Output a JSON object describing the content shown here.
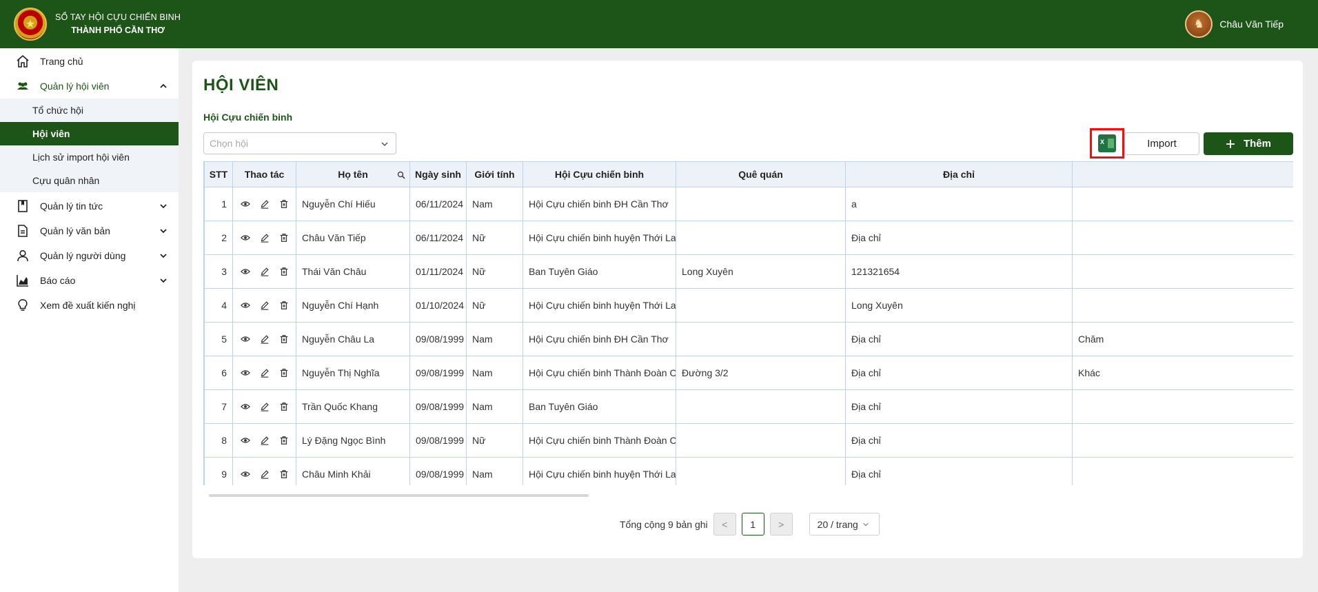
{
  "header": {
    "brand_line1": "SỔ TAY HỘI CỰU CHIẾN BINH",
    "brand_line2": "THÀNH PHỐ CẦN THƠ",
    "user_name": "Châu Văn Tiếp",
    "colors": {
      "primary": "#1d5518",
      "highlight": "#ff0a0a"
    }
  },
  "sidebar": {
    "home": "Trang chủ",
    "members_group": "Quản lý hội viên",
    "members_sub": [
      "Tổ chức hội",
      "Hội viên",
      "Lịch sử import hội viên",
      "Cựu quân nhân"
    ],
    "news": "Quản lý tin tức",
    "docs": "Quản lý văn bản",
    "users": "Quản lý người dùng",
    "reports": "Báo cáo",
    "suggestions": "Xem đề xuất kiến nghị"
  },
  "main": {
    "title": "HỘI VIÊN",
    "filter_label": "Hội Cựu chiến binh",
    "filter_placeholder": "Chọn hội",
    "import_label": "Import",
    "add_label": "Thêm",
    "columns": [
      "STT",
      "Thao tác",
      "Họ tên",
      "Ngày sinh",
      "Giới tính",
      "Hội Cựu chiến binh",
      "Quê quán",
      "Địa chỉ",
      ""
    ],
    "rows": [
      {
        "stt": "1",
        "name": "Nguyễn Chí Hiếu",
        "dob": "06/11/2024",
        "gender": "Nam",
        "assoc": "Hội Cựu chiến binh ĐH Cần Thơ",
        "hometown": "",
        "address": "a",
        "extra": ""
      },
      {
        "stt": "2",
        "name": "Châu Văn Tiếp",
        "dob": "06/11/2024",
        "gender": "Nữ",
        "assoc": "Hội Cựu chiến binh huyện Thới Lai",
        "hometown": "",
        "address": "Địa chỉ",
        "extra": ""
      },
      {
        "stt": "3",
        "name": "Thái Văn Châu",
        "dob": "01/11/2024",
        "gender": "Nữ",
        "assoc": "Ban Tuyên Giáo",
        "hometown": "Long Xuyên",
        "address": "121321654",
        "extra": ""
      },
      {
        "stt": "4",
        "name": "Nguyễn Chí Hạnh",
        "dob": "01/10/2024",
        "gender": "Nữ",
        "assoc": "Hội Cựu chiến binh huyện Thới Lai",
        "hometown": "",
        "address": "Long Xuyên",
        "extra": ""
      },
      {
        "stt": "5",
        "name": "Nguyễn Châu La",
        "dob": "09/08/1999",
        "gender": "Nam",
        "assoc": "Hội Cựu chiến binh ĐH Cần Thơ",
        "hometown": "",
        "address": "Địa chỉ",
        "extra": "Chăm"
      },
      {
        "stt": "6",
        "name": "Nguyễn Thị Nghĩa",
        "dob": "09/08/1999",
        "gender": "Nam",
        "assoc": "Hội Cựu chiến binh Thành Đoàn Cần Thơ",
        "hometown": "Đường 3/2",
        "address": "Địa chỉ",
        "extra": "Khác"
      },
      {
        "stt": "7",
        "name": "Trần Quốc Khang",
        "dob": "09/08/1999",
        "gender": "Nam",
        "assoc": "Ban Tuyên Giáo",
        "hometown": "",
        "address": "Địa chỉ",
        "extra": ""
      },
      {
        "stt": "8",
        "name": "Lý Đặng Ngọc Bình",
        "dob": "09/08/1999",
        "gender": "Nữ",
        "assoc": "Hội Cựu chiến binh Thành Đoàn Cần Thơ",
        "hometown": "",
        "address": "Địa chỉ",
        "extra": ""
      },
      {
        "stt": "9",
        "name": "Châu Minh Khải",
        "dob": "09/08/1999",
        "gender": "Nam",
        "assoc": "Hội Cựu chiến binh huyện Thới Lai",
        "hometown": "",
        "address": "Địa chỉ",
        "extra": ""
      }
    ],
    "pagination": {
      "total_text": "Tổng cộng 9 bản ghi",
      "prev": "<",
      "current": "1",
      "next": ">",
      "page_size": "20 / trang"
    }
  }
}
